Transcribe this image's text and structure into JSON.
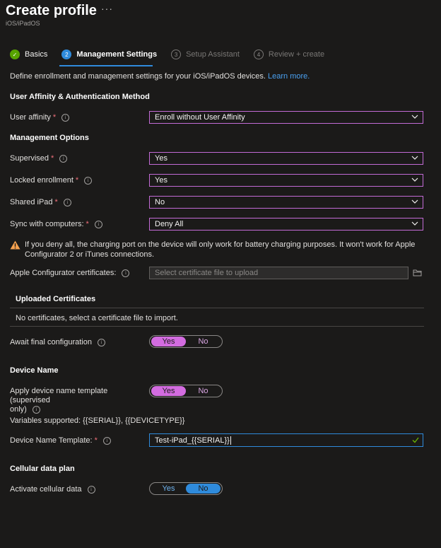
{
  "header": {
    "title": "Create profile",
    "more": "···",
    "subtitle": "iOS/iPadOS"
  },
  "wizard": {
    "steps": [
      {
        "num": "✓",
        "label": "Basics",
        "state": "done"
      },
      {
        "num": "2",
        "label": "Management Settings",
        "state": "current"
      },
      {
        "num": "3",
        "label": "Setup Assistant",
        "state": "todo"
      },
      {
        "num": "4",
        "label": "Review + create",
        "state": "todo"
      }
    ]
  },
  "description": {
    "text": "Define enrollment and management settings for your iOS/iPadOS devices.",
    "link": "Learn more."
  },
  "sections": {
    "affinity": "User Affinity & Authentication Method",
    "management": "Management Options",
    "device_name": "Device Name",
    "cellular": "Cellular data plan"
  },
  "fields": {
    "user_affinity": {
      "label": "User affinity",
      "value": "Enroll without User Affinity"
    },
    "supervised": {
      "label": "Supervised",
      "value": "Yes"
    },
    "locked_enrollment": {
      "label": "Locked enrollment",
      "value": "Yes"
    },
    "shared_ipad": {
      "label": "Shared iPad",
      "value": "No"
    },
    "sync_computers": {
      "label": "Sync with computers:",
      "value": "Deny All"
    },
    "apple_configurator": {
      "label": "Apple Configurator certificates:",
      "placeholder": "Select certificate file to upload"
    },
    "await_final": {
      "label": "Await final configuration",
      "yes": "Yes",
      "no": "No",
      "selected": "Yes"
    },
    "apply_template": {
      "label_line1": "Apply device name template (supervised",
      "label_line2": "only)",
      "yes": "Yes",
      "no": "No",
      "selected": "Yes"
    },
    "variables": "Variables supported: {{SERIAL}}, {{DEVICETYPE}}",
    "device_name_template": {
      "label": "Device Name Template:",
      "value": "Test-iPad_{{SERIAL}}"
    },
    "activate_cellular": {
      "label": "Activate cellular data",
      "yes": "Yes",
      "no": "No",
      "selected": "No"
    }
  },
  "warning": {
    "text": "If you deny all, the charging port on the device will only work for battery charging purposes. It won't work for Apple Configurator 2 or iTunes connections."
  },
  "certificates": {
    "heading": "Uploaded Certificates",
    "empty_text": "No certificates, select a certificate file to import."
  },
  "icons": {
    "info": "i",
    "chevron": "chevron-down-icon",
    "warning": "warning-icon",
    "folder": "folder-icon",
    "check": "checkmark-icon"
  },
  "colors": {
    "accent_purple": "#d36ce0",
    "accent_blue": "#2f8bdc",
    "done_green": "#57a300",
    "warning_orange": "#f7a24f"
  }
}
